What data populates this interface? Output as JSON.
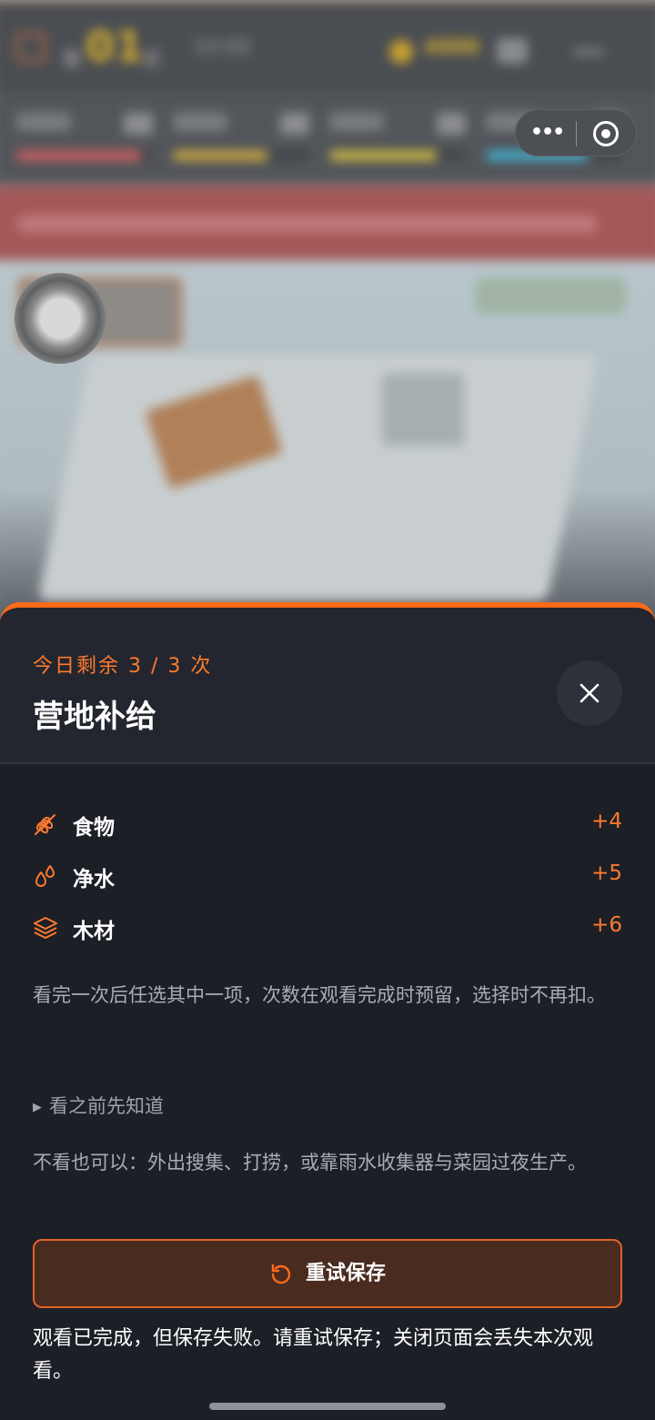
{
  "hud": {
    "day_prefix": "第",
    "day_number": "01",
    "day_suffix": "天",
    "clock": "10:00",
    "coins": "4000"
  },
  "stats": [
    {
      "color": "#d86060",
      "level": 0.92
    },
    {
      "color": "#d8b040",
      "level": 0.7
    },
    {
      "color": "#d8c040",
      "level": 0.79
    },
    {
      "color": "#40b8d8",
      "level": 0.75
    }
  ],
  "sheet": {
    "quota": "今日剩余 3 / 3 次",
    "title": "营地补给",
    "items": [
      {
        "icon": "wheat-icon",
        "name": "食物",
        "value": "+4"
      },
      {
        "icon": "water-drops-icon",
        "name": "净水",
        "value": "+5"
      },
      {
        "icon": "layers-icon",
        "name": "木材",
        "value": "+6"
      }
    ],
    "description": "看完一次后任选其中一项，次数在观看完成时预留，选择时不再扣。",
    "disclosure": "看之前先知道",
    "alternative": "不看也可以：外出搜集、打捞，或靠雨水收集器与菜园过夜生产。",
    "retry_label": "重试保存",
    "error_message": "观看已完成，但保存失败。请重试保存；关闭页面会丢失本次观看。"
  },
  "colors": {
    "accent": "#ff6a1a",
    "sheet_bg": "#1c1f26",
    "button_bg": "#4a2b20"
  }
}
